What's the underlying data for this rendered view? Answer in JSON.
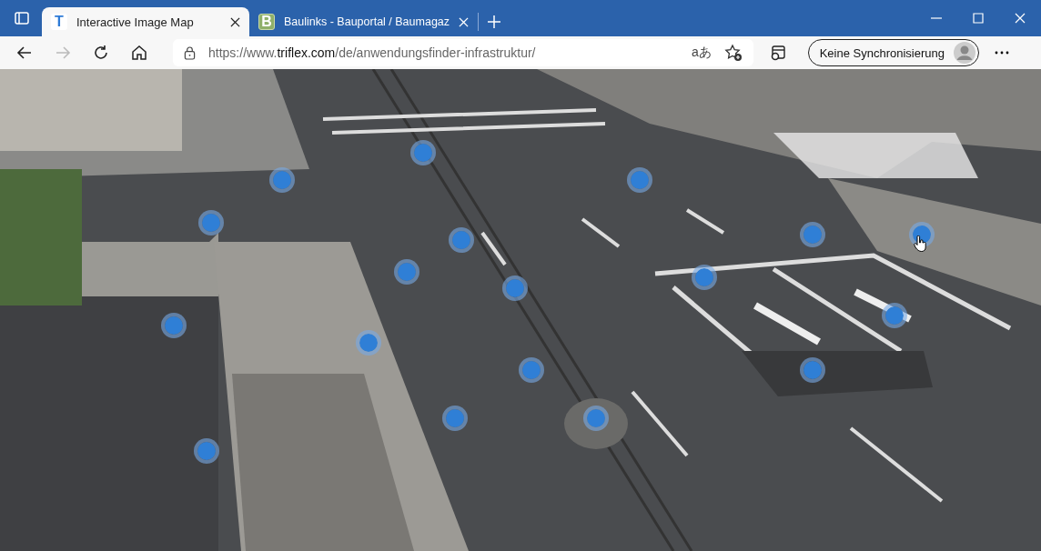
{
  "tabs": [
    {
      "title": "Interactive Image Map",
      "favicon": "T",
      "selected": true
    },
    {
      "title": "Baulinks - Bauportal / Baumagaz",
      "favicon": "B",
      "selected": false
    }
  ],
  "toolbar": {
    "url": {
      "scheme": "https://www.",
      "domain": "triflex.com",
      "path": "/de/anwendungsfinder-infrastruktur/"
    },
    "read_aloud": "aあ",
    "profile_button": "Keine Synchronisierung"
  }
}
